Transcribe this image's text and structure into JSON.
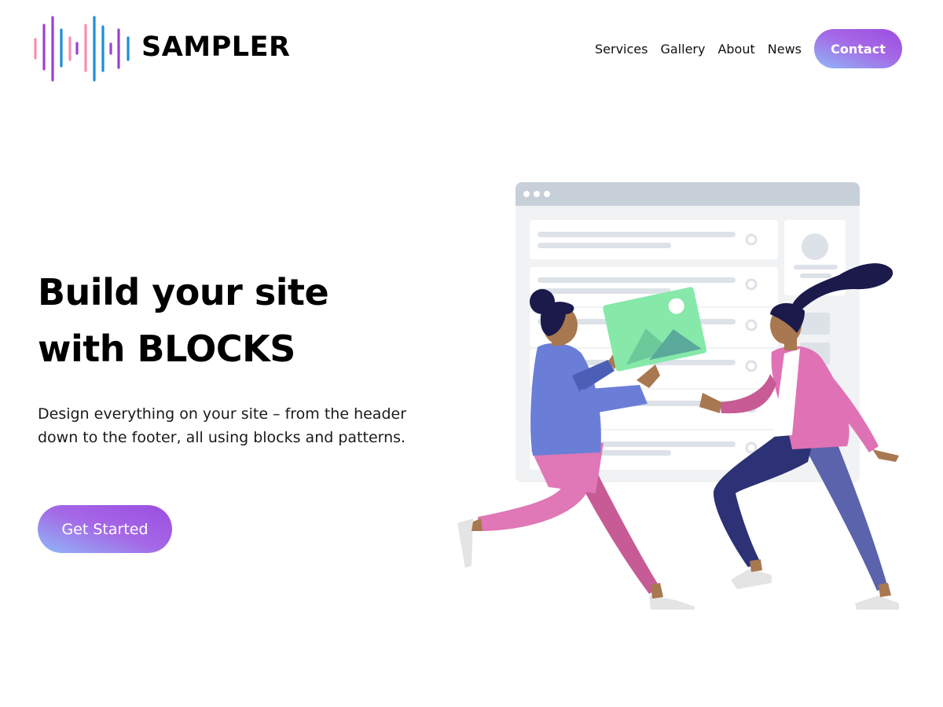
{
  "header": {
    "brand": "SAMPLER",
    "nav": [
      {
        "label": "Services"
      },
      {
        "label": "Gallery"
      },
      {
        "label": "About"
      },
      {
        "label": "News"
      }
    ],
    "contact_label": "Contact"
  },
  "hero": {
    "title_line1": "Build your site",
    "title_line2": "with BLOCKS",
    "description": "Design everything on your site – from the header down to the footer, all using blocks and patterns.",
    "cta_label": "Get Started"
  },
  "icons": {
    "logo": "sound-wave-icon"
  },
  "colors": {
    "accent_gradient_start": "#8fb8f7",
    "accent_gradient_end": "#9b4de0",
    "logo_pink": "#f48fb1",
    "logo_purple": "#9c3fd6",
    "logo_blue": "#1c8fd8"
  }
}
